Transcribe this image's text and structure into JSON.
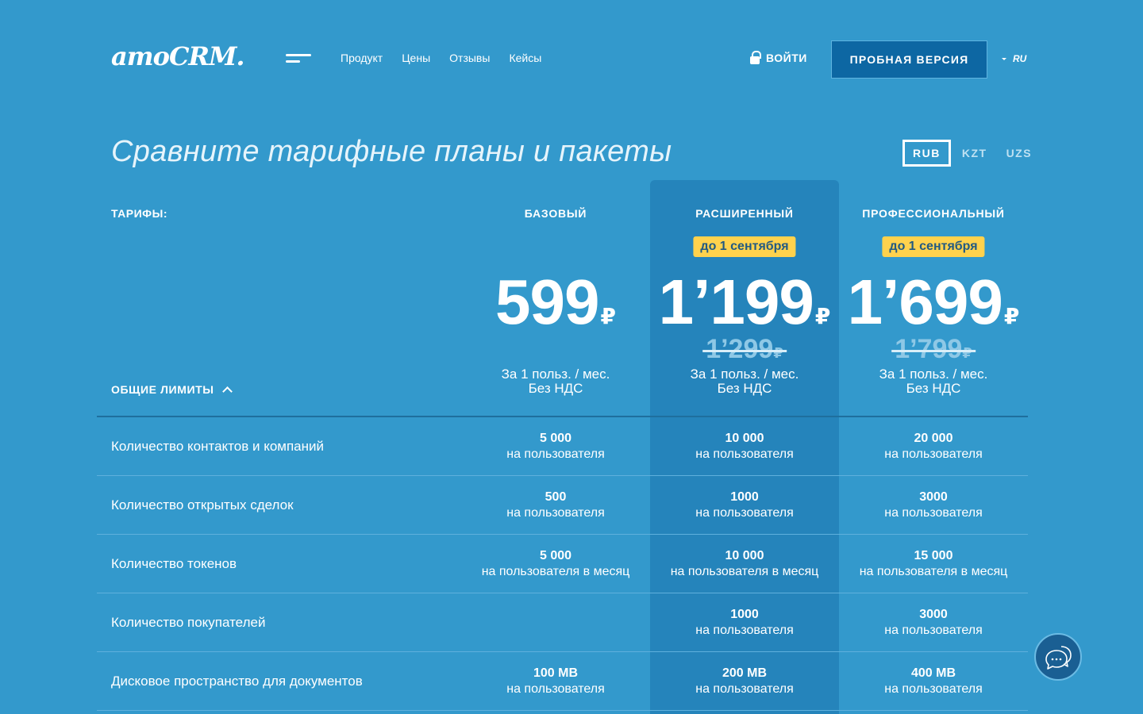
{
  "header": {
    "logo": "amoCRM.",
    "nav": [
      "Продукт",
      "Цены",
      "Отзывы",
      "Кейсы"
    ],
    "login": "ВОЙТИ",
    "trial": "ПРОБНАЯ ВЕРСИЯ",
    "lang": "RU"
  },
  "page": {
    "title": "Сравните тарифные планы и пакеты",
    "currencies": [
      "RUB",
      "KZT",
      "UZS"
    ],
    "active_currency": "RUB",
    "tarifs_label": "ТАРИФЫ:",
    "limits_label": "ОБЩИЕ ЛИМИТЫ"
  },
  "plans": [
    {
      "name": "БАЗОВЫЙ",
      "promo": "",
      "price": "599",
      "currency": "₽",
      "old_price": "",
      "per_line1": "За 1 польз. / мес.",
      "per_line2": "Без НДС"
    },
    {
      "name": "РАСШИРЕННЫЙ",
      "promo": "до 1 сентября",
      "price": "1’199",
      "currency": "₽",
      "old_price": "1’299",
      "per_line1": "За 1 польз. / мес.",
      "per_line2": "Без НДС"
    },
    {
      "name": "ПРОФЕССИОНАЛЬНЫЙ",
      "promo": "до 1 сентября",
      "price": "1’699",
      "currency": "₽",
      "old_price": "1’799",
      "per_line1": "За 1 польз. / мес.",
      "per_line2": "Без НДС"
    }
  ],
  "rows": [
    {
      "label": "Количество контактов и компаний",
      "cells": [
        {
          "val": "5 000",
          "unit": "на пользователя"
        },
        {
          "val": "10 000",
          "unit": "на пользователя"
        },
        {
          "val": "20 000",
          "unit": "на пользователя"
        }
      ]
    },
    {
      "label": "Количество открытых сделок",
      "cells": [
        {
          "val": "500",
          "unit": "на пользователя"
        },
        {
          "val": "1000",
          "unit": "на пользователя"
        },
        {
          "val": "3000",
          "unit": "на пользователя"
        }
      ]
    },
    {
      "label": "Количество токенов",
      "cells": [
        {
          "val": "5 000",
          "unit": "на пользователя в месяц"
        },
        {
          "val": "10 000",
          "unit": "на пользователя в месяц"
        },
        {
          "val": "15 000",
          "unit": "на пользователя в месяц"
        }
      ]
    },
    {
      "label": "Количество покупателей",
      "cells": [
        {
          "val": "",
          "unit": ""
        },
        {
          "val": "1000",
          "unit": "на пользователя"
        },
        {
          "val": "3000",
          "unit": "на пользователя"
        }
      ]
    },
    {
      "label": "Дисковое пространство для документов",
      "cells": [
        {
          "val": "100 MB",
          "unit": "на пользователя"
        },
        {
          "val": "200 MB",
          "unit": "на пользователя"
        },
        {
          "val": "400 MB",
          "unit": "на пользователя"
        }
      ]
    }
  ]
}
